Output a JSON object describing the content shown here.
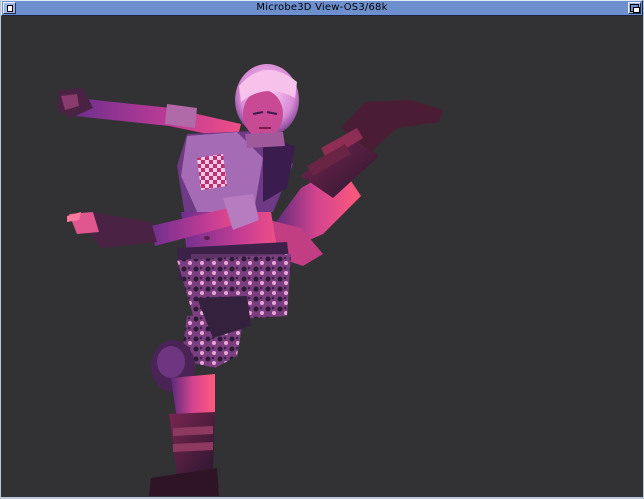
{
  "window": {
    "title": "Microbe3D View-OS3/68k",
    "background_color": "#323133",
    "titlebar_color": "#6d8fce"
  },
  "gadgets": {
    "close": "close-gadget-icon",
    "depth": "depth-gadget-icon"
  },
  "scene": {
    "subject": "character-model",
    "palette": {
      "skin": "#d9428f",
      "shadow": "#3a1c4e",
      "highlight": "#ff5c8a",
      "hair": "#f2a8e6"
    }
  }
}
